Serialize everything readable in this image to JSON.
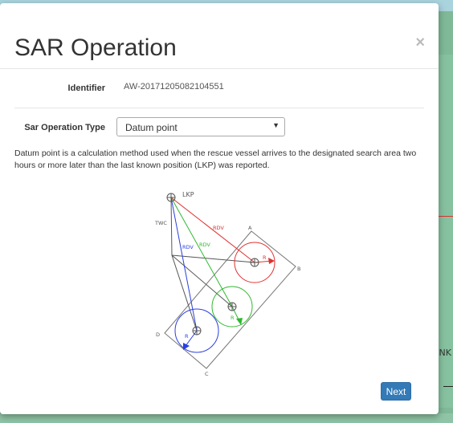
{
  "map": {
    "label": "NK"
  },
  "modal": {
    "title": "SAR Operation",
    "close_glyph": "×",
    "identifier_label": "Identifier",
    "identifier_value": "AW-20171205082104551",
    "type_label": "Sar Operation Type",
    "type_selected": "Datum point",
    "description": "Datum point is a calculation method used when the rescue vessel arrives to the designated search area two hours or more later than the last known position (LKP) was reported.",
    "next_label": "Next"
  },
  "diagram": {
    "lkp": "LKP",
    "twc": "TWC",
    "rdv": "RDV",
    "r": "R",
    "a": "A",
    "b": "B",
    "c": "C",
    "d": "D",
    "colors": {
      "red": "#e03131",
      "green": "#2fb82f",
      "blue": "#2b3fe0",
      "gray": "#777777"
    }
  },
  "icons": {
    "close": "close-icon",
    "dropdown": "chevron-down-icon"
  }
}
